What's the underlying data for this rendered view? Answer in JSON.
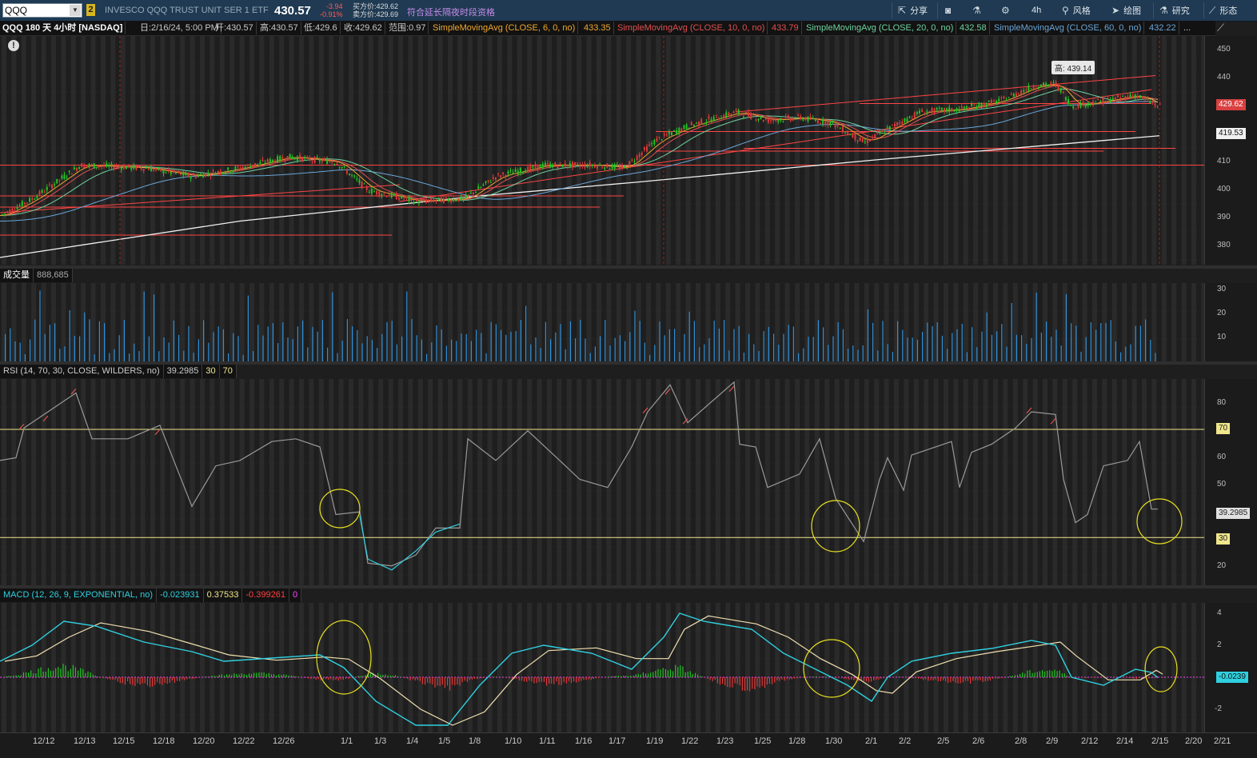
{
  "toolbar": {
    "symbol": "QQQ",
    "link_group": "2",
    "description": "INVESCO QQQ TRUST UNIT SER 1 ETF",
    "last": "430.57",
    "change": "-3.94",
    "change_pct": "-0.91%",
    "bid": "买方价:429.62",
    "ask": "卖方价:429.69",
    "ext_hours": "符合延长隔夜时段资格",
    "share": "分享",
    "aggregation": "4h",
    "style": "风格",
    "drawings": "绘图",
    "studies": "研究",
    "patterns": "形态"
  },
  "study_bar": {
    "symbol_period": "QQQ 180 天 4小时 [NASDAQ]",
    "date": "日:2/16/24, 5:00 PM",
    "open": "开:430.57",
    "high": "高:430.57",
    "low": "低:429.6",
    "close": "收:429.62",
    "range": "范围:0.97",
    "sma6": "SimpleMovingAvg (CLOSE, 6, 0, no)",
    "sma6_val": "433.35",
    "sma10": "SimpleMovingAvg (CLOSE, 10, 0, no)",
    "sma10_val": "433.79",
    "sma20": "SimpleMovingAvg (CLOSE, 20, 0, no)",
    "sma20_val": "432.58",
    "sma60": "SimpleMovingAvg (CLOSE, 60, 0, no)",
    "sma60_val": "432.22",
    "more": "..."
  },
  "price_panel": {
    "y_ticks": [
      "450",
      "440",
      "430",
      "420",
      "410",
      "400",
      "390",
      "380"
    ],
    "last_price_label": "429.62",
    "last_price_color": "#d94040",
    "sma_label": "419.53",
    "high_bubble": "高: 439.14",
    "colors": {
      "up": "#22c422",
      "down": "#e03838",
      "sma6": "#f0a830",
      "sma10": "#e05050",
      "sma20": "#6fd2a0",
      "sma60": "#6aa6d8",
      "sma200": "#f0f0f0",
      "trendline": "#ff4444"
    }
  },
  "volume_panel": {
    "title": "成交量",
    "value": "888,685",
    "y_ticks": [
      "30",
      "20",
      "10"
    ],
    "bar_color": "#2f8fd8"
  },
  "rsi_panel": {
    "title": "RSI (14, 70, 30, CLOSE, WILDERS, no)",
    "value": "39.2985",
    "oversold": "30",
    "overbought": "70",
    "y_ticks": [
      "80",
      "60",
      "50",
      "40",
      "20"
    ],
    "value_label": "39.2985",
    "ob_label": "70",
    "os_label": "30"
  },
  "macd_panel": {
    "title": "MACD (12, 26, 9, EXPONENTIAL, no)",
    "value": "-0.023931",
    "avg": "0.37533",
    "diff": "-0.399261",
    "zero": "0",
    "y_ticks": [
      "4",
      "2",
      "-2"
    ],
    "value_label": "-0.0239"
  },
  "x_axis": [
    "12/12",
    "12/13",
    "12/15",
    "12/18",
    "12/20",
    "12/22",
    "12/26",
    "1/1",
    "1/3",
    "1/4",
    "1/5",
    "1/8",
    "1/10",
    "1/11",
    "1/16",
    "1/17",
    "1/19",
    "1/22",
    "1/23",
    "1/25",
    "1/28",
    "1/30",
    "2/1",
    "2/2",
    "2/5",
    "2/6",
    "2/8",
    "2/9",
    "2/12",
    "2/14",
    "2/15",
    "2/20",
    "2/21"
  ]
}
